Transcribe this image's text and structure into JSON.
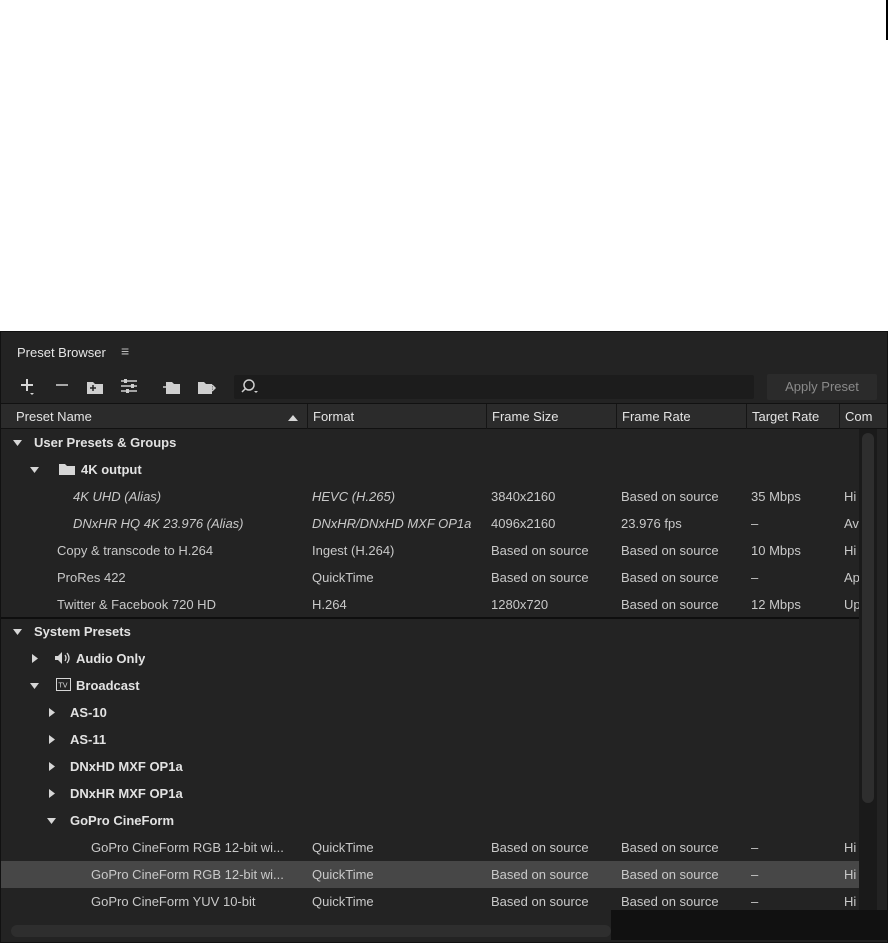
{
  "panel": {
    "title": "Preset Browser",
    "menu_icon": "hamburger-menu-icon"
  },
  "toolbar": {
    "icons": [
      "add-icon",
      "remove-icon",
      "new-group-icon",
      "preset-settings-icon",
      "import-preset-icon",
      "export-preset-icon",
      "search-icon"
    ],
    "search_value": "",
    "apply_label": "Apply Preset"
  },
  "columns": [
    "Preset Name",
    "Format",
    "Frame Size",
    "Frame Rate",
    "Target Rate",
    "Com"
  ],
  "groups": {
    "user": "User Presets & Groups",
    "folder_4k": "4K output",
    "system": "System Presets",
    "audio_only": "Audio Only",
    "broadcast": "Broadcast",
    "as10": "AS-10",
    "as11": "AS-11",
    "dnxhd": "DNxHD MXF OP1a",
    "dnxhr": "DNxHR MXF OP1a",
    "gopro": "GoPro CineForm"
  },
  "rows": [
    {
      "name": "4K UHD (Alias)",
      "format": "HEVC (H.265)",
      "frame_size": "3840x2160",
      "frame_rate": "Based on source",
      "target_rate": "35 Mbps",
      "comment": "Hi"
    },
    {
      "name": "DNxHR HQ 4K 23.976 (Alias)",
      "format": "DNxHR/DNxHD MXF OP1a",
      "frame_size": "4096x2160",
      "frame_rate": "23.976 fps",
      "target_rate": "–",
      "comment": "Av"
    },
    {
      "name": "Copy & transcode to H.264",
      "format": "Ingest (H.264)",
      "frame_size": "Based on source",
      "frame_rate": "Based on source",
      "target_rate": "10 Mbps",
      "comment": "Hi"
    },
    {
      "name": "ProRes 422",
      "format": "QuickTime",
      "frame_size": "Based on source",
      "frame_rate": "Based on source",
      "target_rate": "–",
      "comment": "Ap"
    },
    {
      "name": "Twitter & Facebook 720 HD",
      "format": "H.264",
      "frame_size": "1280x720",
      "frame_rate": "Based on source",
      "target_rate": "12 Mbps",
      "comment": "Up"
    },
    {
      "name": "GoPro CineForm RGB 12-bit wi...",
      "format": "QuickTime",
      "frame_size": "Based on source",
      "frame_rate": "Based on source",
      "target_rate": "–",
      "comment": "Hi"
    },
    {
      "name": "GoPro CineForm RGB 12-bit wi...",
      "format": "QuickTime",
      "frame_size": "Based on source",
      "frame_rate": "Based on source",
      "target_rate": "–",
      "comment": "Hi"
    },
    {
      "name": "GoPro CineForm YUV 10-bit",
      "format": "QuickTime",
      "frame_size": "Based on source",
      "frame_rate": "Based on source",
      "target_rate": "–",
      "comment": "Hi"
    }
  ]
}
